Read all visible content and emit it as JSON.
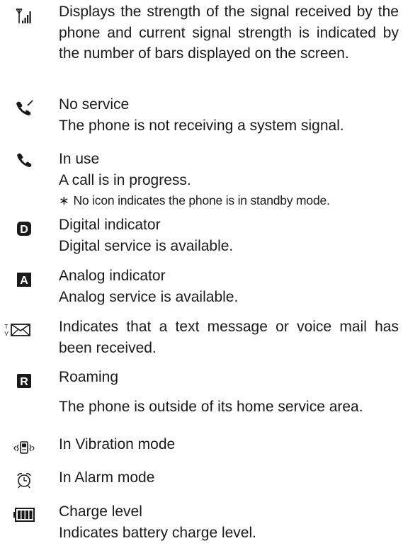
{
  "entries": [
    {
      "icon": "signal-strength-icon",
      "lines": [
        "Displays the strength of the signal received by the phone and current signal strength is indicated by the number of bars displayed on the screen."
      ]
    },
    {
      "icon": "no-service-icon",
      "lines": [
        "No service",
        "The phone is not receiving a system signal."
      ]
    },
    {
      "icon": "in-use-icon",
      "lines": [
        "In use",
        "A call is in progress."
      ],
      "note": "No icon indicates the phone is in standby mode."
    },
    {
      "icon": "digital-indicator-icon",
      "lines": [
        "Digital indicator",
        "Digital service is available."
      ]
    },
    {
      "icon": "analog-indicator-icon",
      "lines": [
        "Analog indicator",
        "Analog service is available."
      ]
    },
    {
      "icon": "message-icon",
      "lines": [
        "Indicates that a text message or voice mail has been received."
      ]
    },
    {
      "icon": "roaming-icon",
      "lines": [
        "Roaming",
        "The phone is outside of its home service area."
      ]
    },
    {
      "icon": "vibration-mode-icon",
      "lines": [
        "In Vibration mode"
      ]
    },
    {
      "icon": "alarm-mode-icon",
      "lines": [
        "In Alarm mode"
      ]
    },
    {
      "icon": "battery-charge-icon",
      "lines": [
        "Charge level",
        "Indicates battery charge level."
      ]
    }
  ],
  "icon_glyphs": {
    "message_prefix": "T V",
    "digital": "D",
    "analog": "A",
    "roaming": "R"
  },
  "note_marker": "∗"
}
